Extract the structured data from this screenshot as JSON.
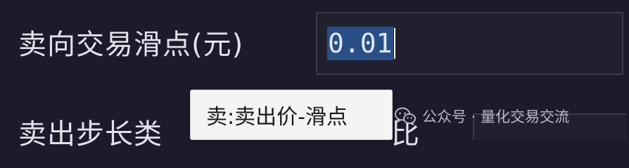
{
  "form": {
    "sell_slippage": {
      "label": "卖向交易滑点(元)",
      "value": "0.01"
    },
    "sell_step": {
      "label_visible_left": "卖出步长类",
      "label_visible_right": "比"
    }
  },
  "tooltip": {
    "text": "卖:卖出价-滑点"
  },
  "watermark": {
    "icon": "wechat-icon",
    "text": "公众号 · 量化交易交流"
  },
  "colors": {
    "background": "#1b1b2c",
    "selection": "#2a4f86",
    "tooltip_bg": "#f4f4f4"
  }
}
